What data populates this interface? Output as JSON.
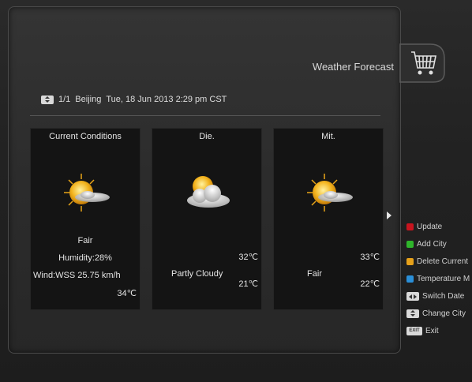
{
  "header": {
    "title": "Weather Forecast"
  },
  "location": {
    "page": "1/1",
    "city": "Beijing",
    "datetime": "Tue, 18 Jun 2013 2:29 pm CST"
  },
  "cards": [
    {
      "heading": "Current Conditions",
      "icon": "sun-cloud-icon",
      "condition": "Fair",
      "humidity": "Humidity:28%",
      "wind": "Wind:WSS 25.75 km/h",
      "temp": "34℃"
    },
    {
      "heading": "Die.",
      "icon": "partly-cloudy-icon",
      "condition": "Partly Cloudy",
      "high": "32℃",
      "low": "21℃"
    },
    {
      "heading": "Mit.",
      "icon": "sun-cloud-icon",
      "condition": "Fair",
      "high": "33℃",
      "low": "22℃"
    }
  ],
  "legend": [
    {
      "label": "Update",
      "color": "#c8141e"
    },
    {
      "label": "Add City",
      "color": "#2fb52b"
    },
    {
      "label": "Delete Current",
      "color": "#e6a11a"
    },
    {
      "label": "Temperature M",
      "color": "#2a8fd8"
    },
    {
      "label": "Switch Date",
      "icon": "left-right-key-icon"
    },
    {
      "label": "Change City",
      "icon": "up-down-key-icon"
    },
    {
      "label": "Exit",
      "icon": "exit-key-icon"
    }
  ],
  "exit_key_text": "EXIT"
}
